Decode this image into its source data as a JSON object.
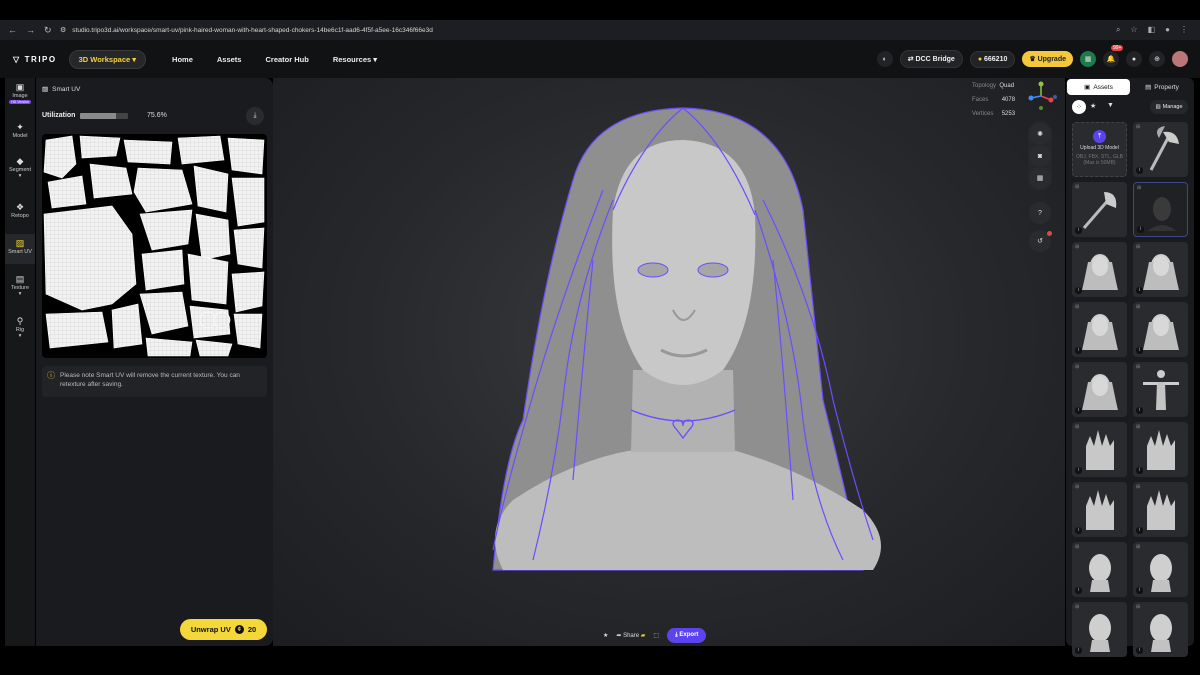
{
  "browser": {
    "url": "studio.tripo3d.ai/workspace/smart-uv/pink-haired-woman-with-heart-shaped-chokers-14be6c1f-aad6-4f5f-a5ee-16c346f66e3d"
  },
  "topbar": {
    "logo": "TRIPO",
    "workspace": "3D Workspace",
    "nav": [
      "Home",
      "Assets",
      "Creator Hub",
      "Resources"
    ],
    "dcc_bridge": "DCC Bridge",
    "credits": "666210",
    "upgrade": "Upgrade",
    "notif_badge": "99+"
  },
  "rail": {
    "image": "Image",
    "image_badge": "HD Version",
    "model": "Model",
    "segment": "Segment",
    "retopo": "Retopo",
    "smart_uv": "Smart UV",
    "texture": "Texture",
    "rig": "Rig"
  },
  "panel": {
    "title": "Smart UV",
    "utilization_label": "Utilization",
    "utilization_value": "75.6%",
    "utilization_fraction": 0.756,
    "note": "Please note Smart UV will remove the current texture. You can retexture after saving.",
    "unwrap_label": "Unwrap UV",
    "unwrap_cost": "20"
  },
  "viewport": {
    "topology_label": "Topology",
    "topology_value": "Quad",
    "faces_label": "Faces",
    "faces_value": "4078",
    "vertices_label": "Vertices",
    "vertices_value": "5253",
    "share": "Share",
    "export": "Export"
  },
  "right_panel": {
    "tab_assets": "Assets",
    "tab_property": "Property",
    "manage": "Manage",
    "upload_title": "Upload 3D Model",
    "upload_formats": "OBJ, FBX, STL, GLB",
    "upload_size": "(Max is 50MB)"
  },
  "colors": {
    "accent_yellow": "#f4d73b",
    "export_purple": "#5b44f0",
    "wireframe": "#6d4cff"
  }
}
